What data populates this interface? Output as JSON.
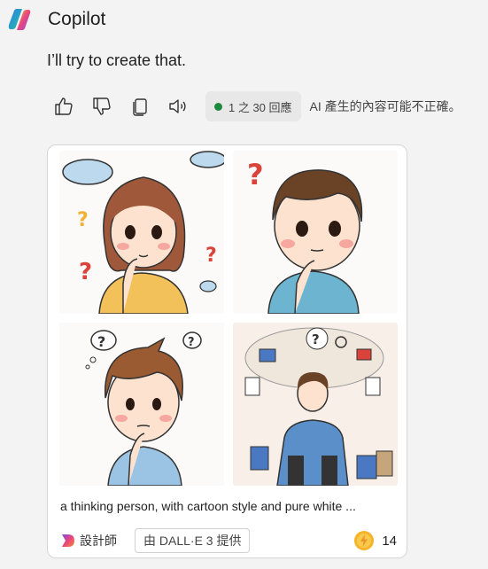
{
  "header": {
    "app_name": "Copilot"
  },
  "message": {
    "text": "I’ll try to create that."
  },
  "actions": {
    "icons": [
      "thumbs-up-icon",
      "thumbs-down-icon",
      "copy-icon",
      "speaker-icon"
    ],
    "counter": "1 之 30 回應",
    "counter_dot_color": "#1e8a3d",
    "disclaimer": "AI 產生的內容可能不正確。"
  },
  "card": {
    "images": [
      "thinking-girl",
      "thinking-boy-blue-shirt",
      "thinking-boy-brown-hair",
      "thinking-man-with-thought-bubbles"
    ],
    "caption": "a thinking person, with cartoon style and pure white ...",
    "designer_label": "設計師",
    "powered_by": "由 DALL·E 3 提供",
    "boost_count": "14"
  }
}
